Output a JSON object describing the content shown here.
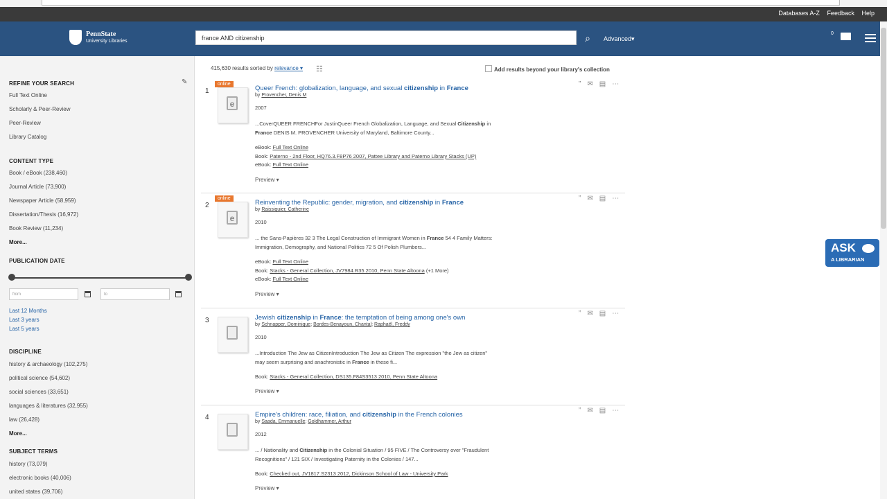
{
  "utility_links": [
    "Databases A-Z",
    "Feedback",
    "Help"
  ],
  "logo": {
    "line1": "PennState",
    "line2": "University Libraries"
  },
  "search": {
    "value": "france AND citizenship",
    "advanced": "Advanced▾"
  },
  "folder_count": "0",
  "sidebar": {
    "refine_heading": "REFINE YOUR SEARCH",
    "refine_items": [
      "Full Text Online",
      "Scholarly & Peer-Review",
      "Peer-Review",
      "Library Catalog"
    ],
    "content_type_heading": "CONTENT TYPE",
    "content_type_items": [
      "Book / eBook (238,460)",
      "Journal Article (73,900)",
      "Newspaper Article (58,959)",
      "Dissertation/Thesis (16,972)",
      "Book Review (11,234)"
    ],
    "more1": "More...",
    "pub_date_heading": "PUBLICATION DATE",
    "from_placeholder": "from",
    "to_placeholder": "to",
    "date_links": [
      "Last 12 Months",
      "Last 3 years",
      "Last 5 years"
    ],
    "discipline_heading": "DISCIPLINE",
    "discipline_items": [
      "history & archaeology (102,275)",
      "political science (54,602)",
      "social sciences (33,651)",
      "languages & literatures (32,955)",
      "law (26,428)"
    ],
    "more2": "More...",
    "subject_heading": "SUBJECT TERMS",
    "subject_items": [
      "history (73,079)",
      "electronic books (40,006)",
      "united states (39,706)"
    ]
  },
  "results_header": {
    "count": "415,630 results sorted by",
    "sort": "relevance ▾",
    "beyond": "Add results beyond your library's collection"
  },
  "results": [
    {
      "num": "1",
      "badge": "online",
      "type_glyph": "e",
      "title_pre": "Queer French: globalization, language, and sexual ",
      "title_b1": "citizenship",
      "title_mid": " in ",
      "title_b2": "France",
      "title_post": "",
      "by": "by",
      "authors": [
        "Provencher, Denis M"
      ],
      "year": "2007",
      "snippet_l1_pre": "...CoverQUEER FRENCHFor JustinQueer French Globalization, Language, and Sexual ",
      "snippet_l1_b": "Citizenship",
      "snippet_l1_post": " in",
      "snippet_l2_b": "France",
      "snippet_l2_post": " DENIS M. PROVENCHER University of Maryland, Baltimore County...",
      "holdings": [
        {
          "label": "eBook: ",
          "link": "Full Text Online",
          "extra": ""
        },
        {
          "label": "Book: ",
          "link": "Paterno - 2nd Floor, HQ76.3.F8P76 2007, Pattee Library and Paterno Library Stacks (UP)",
          "extra": ""
        },
        {
          "label": "eBook: ",
          "link": "Full Text Online",
          "extra": ""
        }
      ],
      "preview": "Preview ▾"
    },
    {
      "num": "2",
      "badge": "online",
      "type_glyph": "e",
      "title_pre": "Reinventing the Republic: gender, migration, and ",
      "title_b1": "citizenship",
      "title_mid": " in ",
      "title_b2": "France",
      "title_post": "",
      "by": "by",
      "authors": [
        "Raissiquier, Catherine"
      ],
      "year": "2010",
      "snippet_l1_pre": "... the Sans-Papières 32 3 The Legal Construction of Immigrant Women in ",
      "snippet_l1_b": "France",
      "snippet_l1_post": " 54 4 Family Matters:",
      "snippet_l2_b": "",
      "snippet_l2_post": "Immigration, Demography, and National Politics 72 5 Of Polish Plumbers...",
      "holdings": [
        {
          "label": "eBook: ",
          "link": "Full Text Online",
          "extra": ""
        },
        {
          "label": "Book: ",
          "link": "Stacks - General Collection, JV7984.R35 2010, Penn State Altoona",
          "extra": " (+1 More)"
        },
        {
          "label": "eBook: ",
          "link": "Full Text Online",
          "extra": ""
        }
      ],
      "preview": "Preview ▾"
    },
    {
      "num": "3",
      "badge": "",
      "type_glyph": "",
      "title_pre": "Jewish ",
      "title_b1": "citizenship",
      "title_mid": " in ",
      "title_b2": "France",
      "title_post": ": the temptation of being among one's own",
      "by": "by",
      "authors": [
        "Schnapper, Dominique",
        "Bordes-Benayoun, Chantal",
        "Raphaël, Freddy"
      ],
      "year": "2010",
      "snippet_l1_pre": "...Introduction The Jew as CitizenIntroduction The Jew as Citizen The expression \"the Jew as citizen\"",
      "snippet_l1_b": "",
      "snippet_l1_post": "",
      "snippet_l2_b": "",
      "snippet_l2_post": "may seem surprising and anachronistic in ",
      "snippet_l2_b2": "France",
      "snippet_l2_post2": " in these fi...",
      "holdings": [
        {
          "label": "Book: ",
          "link": "Stacks - General Collection, DS135.F84S3513 2010, Penn State Altoona",
          "extra": ""
        }
      ],
      "preview": "Preview ▾"
    },
    {
      "num": "4",
      "badge": "",
      "type_glyph": "",
      "title_pre": "Empire's children: race, filiation, and ",
      "title_b1": "citizenship",
      "title_mid": " in the French colonies",
      "title_b2": "",
      "title_post": "",
      "by": "by",
      "authors": [
        "Saada, Emmanuelle",
        "Goldhammer, Arthur"
      ],
      "year": "2012",
      "snippet_l1_pre": "... / Nationality and ",
      "snippet_l1_b": "Citizenship",
      "snippet_l1_post": " in the Colonial Situation / 95 FIVE / The Controversy over \"Fraudulent",
      "snippet_l2_b": "",
      "snippet_l2_post": "Recognitions\" / 121 SIX / Investigating Paternity in the Colonies / 147...",
      "holdings": [
        {
          "label": "Book: ",
          "link": "Checked out, JV1817.S2313 2012, Dickinson School of Law - University Park",
          "extra": ""
        }
      ],
      "preview": "Preview ▾"
    }
  ],
  "ask": {
    "line1": "ASK",
    "line2": "A LIBRARIAN"
  },
  "icons": {
    "cite": "quote-icon",
    "email": "email-icon",
    "save": "folder-icon",
    "more": "more-icon"
  }
}
